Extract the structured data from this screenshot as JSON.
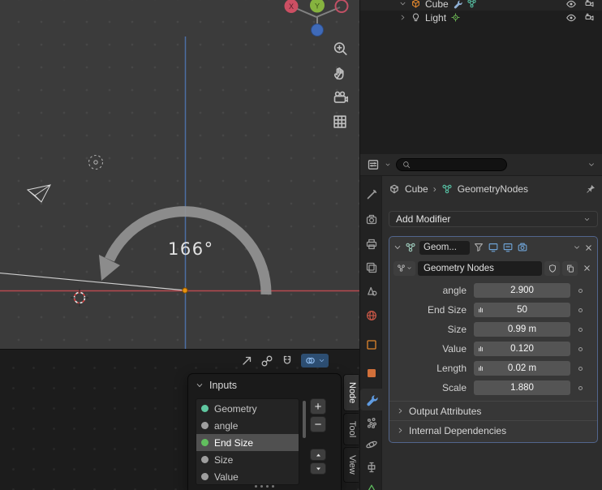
{
  "viewport": {
    "angle_label": "166°",
    "gizmo": {
      "x": "X",
      "y": "Y"
    }
  },
  "outliner": {
    "rows": [
      {
        "name": "Cube"
      },
      {
        "name": "Light"
      }
    ]
  },
  "properties": {
    "breadcrumb": {
      "object": "Cube",
      "separator": "›",
      "modifier": "GeometryNodes"
    },
    "add_modifier_label": "Add Modifier",
    "modifier": {
      "name_display": "Geom...",
      "node_tree_name": "Geometry Nodes",
      "fields": [
        {
          "label": "angle",
          "value": "2.900"
        },
        {
          "label": "End Size",
          "value": "50"
        },
        {
          "label": "Size",
          "value": "0.99 m"
        },
        {
          "label": "Value",
          "value": "0.120"
        },
        {
          "label": "Length",
          "value": "0.02 m"
        },
        {
          "label": "Scale",
          "value": "1.880"
        }
      ],
      "subpanels": [
        {
          "label": "Output Attributes"
        },
        {
          "label": "Internal Dependencies"
        }
      ]
    }
  },
  "node_editor": {
    "inputs_panel": {
      "title": "Inputs",
      "add_label": "+",
      "remove_label": "−",
      "items": [
        {
          "label": "Geometry",
          "socket_color": "#5fc7a0"
        },
        {
          "label": "angle",
          "socket_color": "#9e9e9e"
        },
        {
          "label": "End Size",
          "socket_color": "#61bf5e"
        },
        {
          "label": "Size",
          "socket_color": "#9e9e9e"
        },
        {
          "label": "Value",
          "socket_color": "#9e9e9e"
        }
      ]
    },
    "tabs": [
      {
        "label": "Node"
      },
      {
        "label": "Tool"
      },
      {
        "label": "View"
      }
    ]
  },
  "colors": {
    "axis_x_line": "#b84a50",
    "vertical_axis_line": "#4f74b0",
    "active_modifier_outline": "#52658c",
    "value_field_bg": "#545454",
    "origin_point": "#e8930c",
    "active_tab_icon": "#5f9be0"
  }
}
